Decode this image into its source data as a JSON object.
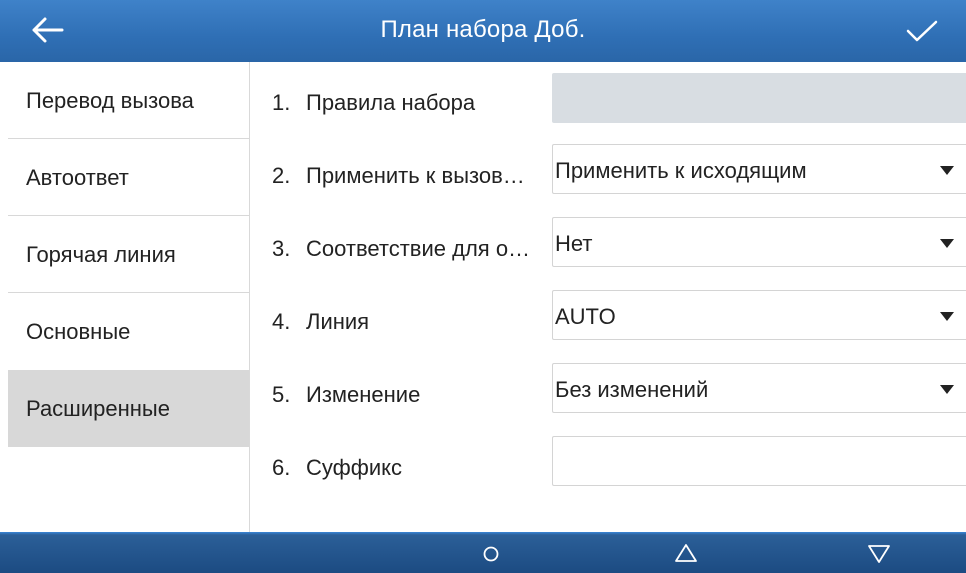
{
  "header": {
    "title": "План набора Доб.",
    "back_icon": "arrow-left-icon",
    "confirm_icon": "checkmark-icon"
  },
  "sidebar": {
    "items": [
      {
        "label": "Перевод вызова",
        "active": false
      },
      {
        "label": "Автоответ",
        "active": false
      },
      {
        "label": "Горячая линия",
        "active": false
      },
      {
        "label": "Основные",
        "active": false
      },
      {
        "label": "Расширенные",
        "active": true
      }
    ]
  },
  "form": {
    "rows": [
      {
        "num": "1.",
        "label": "Правила набора",
        "value": "",
        "type": "text",
        "disabled": true
      },
      {
        "num": "2.",
        "label": "Применить к вызов…",
        "value": "Применить к исходящим",
        "type": "select"
      },
      {
        "num": "3.",
        "label": "Соответствие для о…",
        "value": "Нет",
        "type": "select"
      },
      {
        "num": "4.",
        "label": "Линия",
        "value": "AUTO",
        "type": "select"
      },
      {
        "num": "5.",
        "label": "Изменение",
        "value": "Без изменений",
        "type": "select"
      },
      {
        "num": "6.",
        "label": "Суффикс",
        "value": "",
        "type": "text"
      }
    ]
  },
  "navbar": {
    "icons": [
      "home-circle-icon",
      "back-triangle-up-icon",
      "triangle-down-icon"
    ]
  },
  "colors": {
    "header_bg": "#2f6fb5",
    "navbar_bg": "#1c4b82",
    "active_item_bg": "#d8d8d8",
    "disabled_field_bg": "#d8dde2"
  }
}
